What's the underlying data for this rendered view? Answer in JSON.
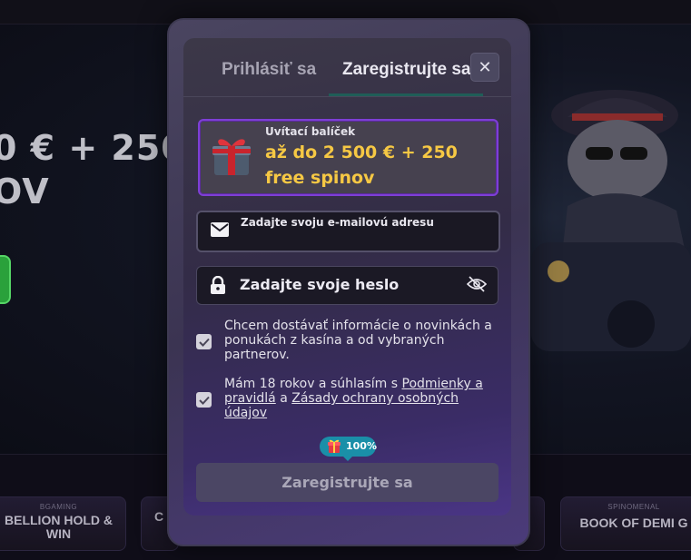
{
  "background": {
    "hero_title_lines": [
      "0 € + 250",
      "OV"
    ],
    "games": [
      {
        "provider": "BGAMING",
        "name": "BELLION HOLD & WIN"
      },
      {
        "provider": "",
        "name": "C"
      },
      {
        "provider": "SPINOMENAL",
        "name": "BOOK OF DEMI G"
      }
    ]
  },
  "modal": {
    "tabs": [
      {
        "label": "Prihlásiť sa",
        "active": false
      },
      {
        "label": "Zaregistrujte sa",
        "active": true
      }
    ],
    "close_symbol": "✕",
    "bonus": {
      "kicker": "Uvítací balíček",
      "amount": "až do 2 500 € + 250 free spinov",
      "icon": "gift-icon"
    },
    "email": {
      "label": "Zadajte svoju e-mailovú adresu",
      "icon": "envelope-icon"
    },
    "password": {
      "label": "Zadajte svoje heslo",
      "icon": "lock-icon",
      "toggle_icon": "eye-off-icon"
    },
    "consents": {
      "marketing": {
        "text": "Chcem dostávať informácie o novinkách a ponukách z kasína a od vybraných partnerov.",
        "checked": true
      },
      "terms": {
        "prefix": "Mám 18 rokov a súhlasím s ",
        "terms_link": "Podmienky a pravidlá",
        "middle": " a ",
        "privacy_link": "Zásady ochrany osobných údajov",
        "checked": true
      }
    },
    "progress": {
      "label": "100%",
      "value": 1.0
    },
    "submit_label": "Zaregistrujte sa",
    "colors": {
      "accent_purple": "#7e3fd6",
      "bonus_yellow": "#f6c844",
      "progress_teal": "#1a8fa8"
    }
  }
}
